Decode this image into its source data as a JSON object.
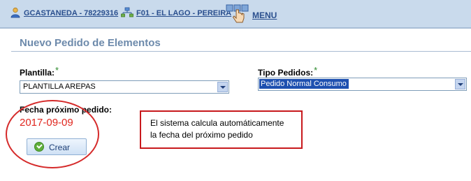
{
  "header": {
    "user_link": "GCASTANEDA - 78229316",
    "office_link": "F01 - EL LAGO - PEREIRA",
    "menu_link": "MENU",
    "icons": [
      "user-icon",
      "office-network-icon",
      "menu-hand-icon"
    ]
  },
  "page": {
    "title": "Nuevo Pedido de Elementos"
  },
  "form": {
    "plantilla_label": "Plantilla:",
    "plantilla_value": "PLANTILLA AREPAS",
    "tipo_label": "Tipo Pedidos:",
    "tipo_value": "Pedido Normal Consumo",
    "required_mark": "*",
    "fecha_label": "Fecha próximo pedido:",
    "fecha_value": "2017-09-09",
    "crear_label": "Crear"
  },
  "annotation": {
    "line1": "El sistema calcula automáticamente",
    "line2": "la fecha del próximo pedido"
  },
  "colors": {
    "header_bg": "#c9daec",
    "link": "#2a4f8e",
    "title": "#6d8aab",
    "highlight_red": "#d52a2a",
    "date_red": "#e0271f",
    "required_green": "#2e8b2e",
    "select_highlight": "#1e50b0"
  }
}
